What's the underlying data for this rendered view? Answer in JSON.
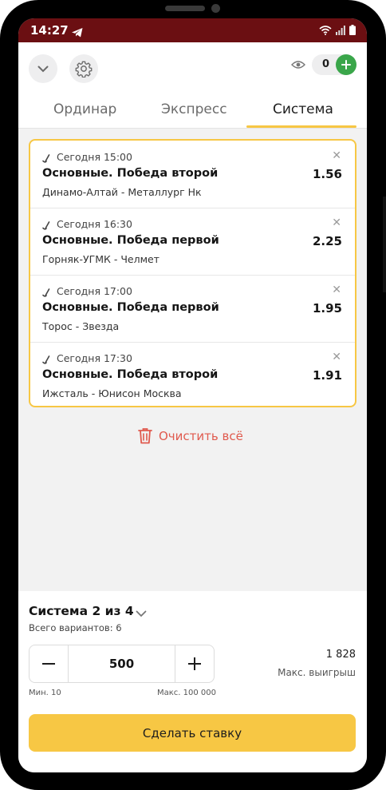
{
  "status_bar": {
    "time": "14:27"
  },
  "header": {
    "counter_value": "0",
    "tabs": [
      {
        "label": "Ординар",
        "active": false
      },
      {
        "label": "Экспресс",
        "active": false
      },
      {
        "label": "Система",
        "active": true
      }
    ]
  },
  "bets": [
    {
      "time": "Сегодня 15:00",
      "market": "Основные. Победа второй",
      "teams": "Динамо-Алтай - Металлург Нк",
      "odd": "1.56"
    },
    {
      "time": "Сегодня 16:30",
      "market": "Основные. Победа первой",
      "teams": "Горняк-УГМК - Челмет",
      "odd": "2.25"
    },
    {
      "time": "Сегодня 17:00",
      "market": "Основные. Победа первой",
      "teams": "Торос - Звезда",
      "odd": "1.95"
    },
    {
      "time": "Сегодня 17:30",
      "market": "Основные. Победа второй",
      "teams": "Ижсталь - Юнисон Москва",
      "odd": "1.91"
    }
  ],
  "clear_all_label": "Очистить всё",
  "bottom": {
    "system_title": "Система 2 из 4",
    "variants": "Всего вариантов: 6",
    "stake": "500",
    "min": "Мин. 10",
    "max": "Макс. 100 000",
    "max_win_value": "1 828",
    "max_win_label": "Макс. выигрыш",
    "bet_button": "Сделать ставку"
  },
  "colors": {
    "accent": "#f7c744",
    "status_bar": "#6b0f12",
    "plus_green": "#3aa64a",
    "clear_red": "#e05a4e"
  }
}
